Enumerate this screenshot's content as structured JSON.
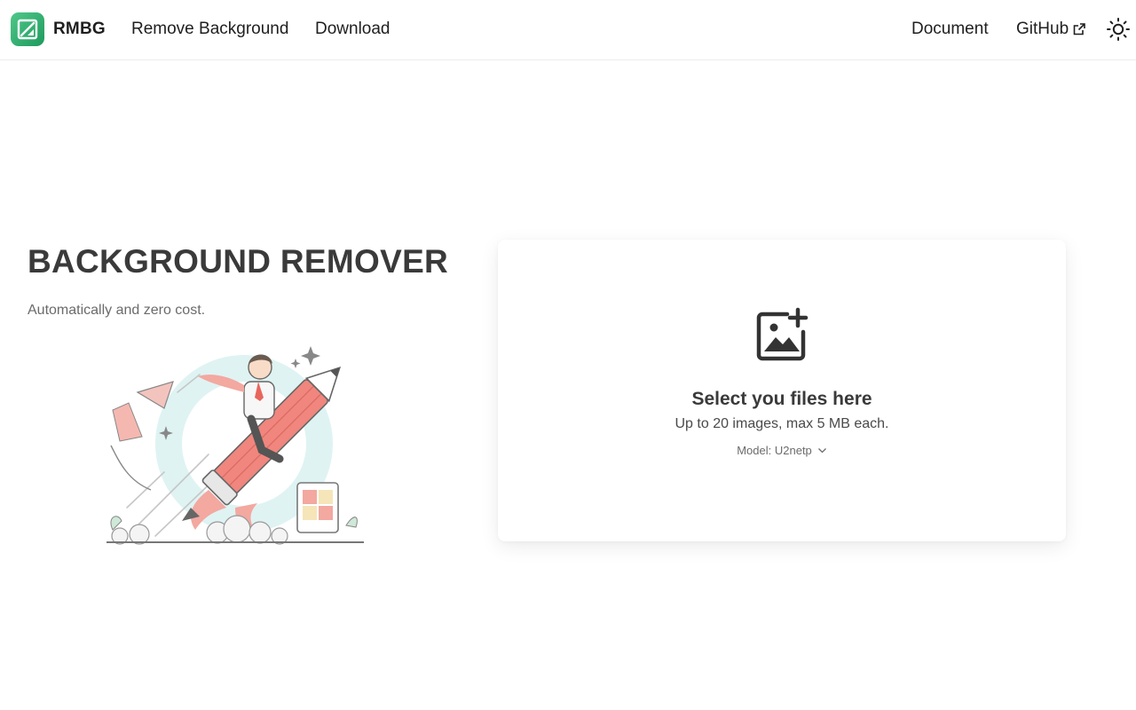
{
  "brand": {
    "name": "RMBG",
    "logo_icon": "image-edit-icon",
    "color": "#2fb271"
  },
  "nav": {
    "remove_background": "Remove Background",
    "download": "Download",
    "document": "Document",
    "github": "GitHub",
    "external_icon": "external-link-icon",
    "theme_icon": "sun-icon"
  },
  "hero": {
    "title": "BACKGROUND REMOVER",
    "subtitle": "Automatically and zero cost.",
    "illustration": "person-riding-pencil-rocket-illustration"
  },
  "upload": {
    "icon": "image-add-icon",
    "title": "Select you files here",
    "hint": "Up to 20 images, max 5 MB each.",
    "model_label": "Model:",
    "model_value": "U2netp",
    "dropdown_icon": "chevron-down-icon"
  }
}
